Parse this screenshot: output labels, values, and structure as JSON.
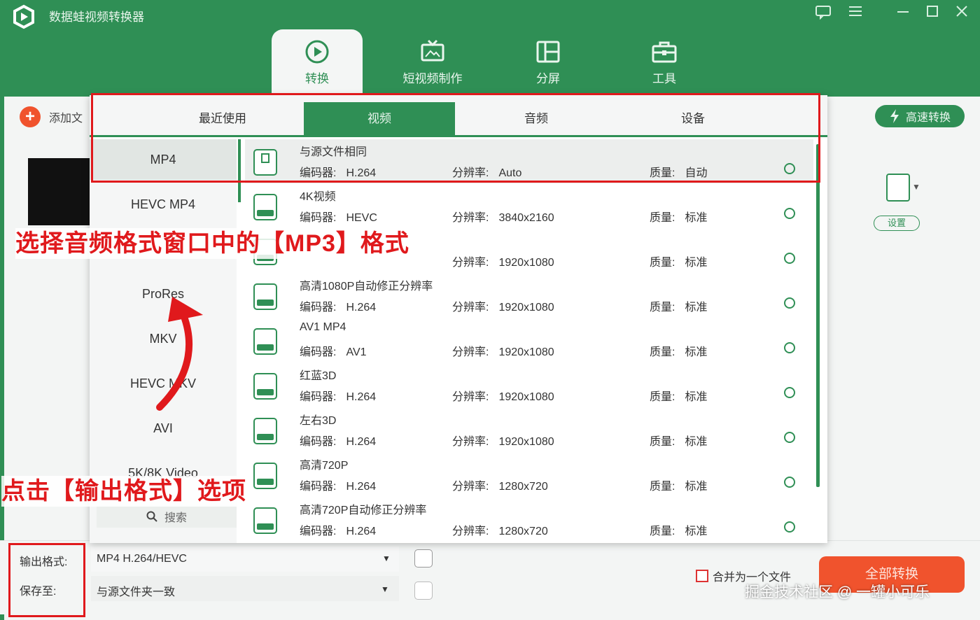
{
  "app": {
    "title": "数据蛙视频转换器"
  },
  "nav": {
    "tabs": [
      {
        "label": "转换",
        "active": true
      },
      {
        "label": "短视频制作",
        "active": false
      },
      {
        "label": "分屏",
        "active": false
      },
      {
        "label": "工具",
        "active": false
      }
    ]
  },
  "toolbar": {
    "add_file": "添加文",
    "fast_convert": "高速转换",
    "settings": "设置"
  },
  "popup": {
    "tabs": [
      {
        "label": "最近使用",
        "active": false
      },
      {
        "label": "视频",
        "active": true
      },
      {
        "label": "音频",
        "active": false
      },
      {
        "label": "设备",
        "active": false
      }
    ],
    "formats": [
      "MP4",
      "HEVC MP4",
      "",
      "ProRes",
      "MKV",
      "HEVC MKV",
      "AVI",
      "5K/8K Video"
    ],
    "search": "搜索",
    "labels": {
      "codec": "编码器:",
      "resolution": "分辨率:",
      "quality": "质量:"
    },
    "presets": [
      {
        "name": "与源文件相同",
        "codec": "H.264",
        "resolution": "Auto",
        "quality": "自动"
      },
      {
        "name": "4K视频",
        "codec": "HEVC",
        "resolution": "3840x2160",
        "quality": "标准"
      },
      {
        "name": "",
        "codec": "",
        "resolution": "1920x1080",
        "quality": "标准"
      },
      {
        "name": "高清1080P自动修正分辨率",
        "codec": "H.264",
        "resolution": "1920x1080",
        "quality": "标准"
      },
      {
        "name": "AV1 MP4",
        "codec": "AV1",
        "resolution": "1920x1080",
        "quality": "标准"
      },
      {
        "name": "红蓝3D",
        "codec": "H.264",
        "resolution": "1920x1080",
        "quality": "标准"
      },
      {
        "name": "左右3D",
        "codec": "H.264",
        "resolution": "1920x1080",
        "quality": "标准"
      },
      {
        "name": "高清720P",
        "codec": "H.264",
        "resolution": "1280x720",
        "quality": "标准"
      },
      {
        "name": "高清720P自动修正分辨率",
        "codec": "H.264",
        "resolution": "1280x720",
        "quality": "标准"
      }
    ]
  },
  "bottom": {
    "output_label": "输出格式:",
    "output_value": "MP4 H.264/HEVC",
    "save_label": "保存至:",
    "save_value": "与源文件夹一致",
    "merge_label": "合并为一个文件",
    "convert_all": "全部转换"
  },
  "annotations": {
    "top": "选择音频格式窗口中的【MP3】格式",
    "bottom": "点击【输出格式】选项"
  },
  "watermark": "掘金技术社区 @ 一罐小可乐",
  "colors": {
    "brand_green": "#2f8f55",
    "accent_orange": "#f0532d",
    "annotation_red": "#e0191c"
  }
}
